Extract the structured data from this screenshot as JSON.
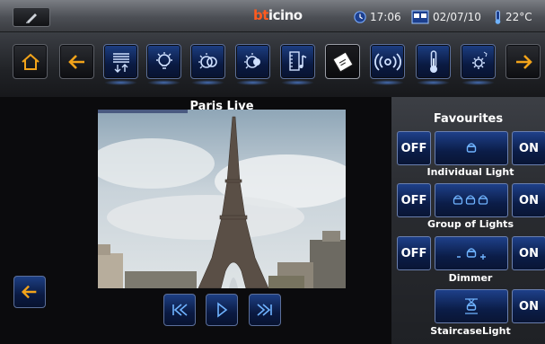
{
  "header": {
    "logo": {
      "part1": "bt",
      "part2": "icino"
    },
    "time": "17:06",
    "date": "02/07/10",
    "temperature": "22°C"
  },
  "toolbar": {
    "icons": [
      "home-icon",
      "back-arrow-icon",
      "shutters-icon",
      "light-bulb-icon",
      "dimmer-icon",
      "dimmer-alt-icon",
      "multimedia-icon",
      "scenarios-icon",
      "wireless-signal-icon",
      "thermometer-icon",
      "settings-icon",
      "forward-arrow-icon"
    ]
  },
  "main": {
    "camera_title": "Paris Live"
  },
  "favourites": {
    "title": "Favourites",
    "items": [
      {
        "label": "Individual Light",
        "off": "OFF",
        "on": "ON"
      },
      {
        "label": "Group of Lights",
        "off": "OFF",
        "on": "ON"
      },
      {
        "label": "Dimmer",
        "off": "OFF",
        "on": "ON"
      },
      {
        "label": "StaircaseLight",
        "on": "ON"
      }
    ]
  },
  "colors": {
    "accent_blue": "#1e4089",
    "logo_red": "#ff5a1e",
    "icon_blue": "#6fb3ff"
  }
}
